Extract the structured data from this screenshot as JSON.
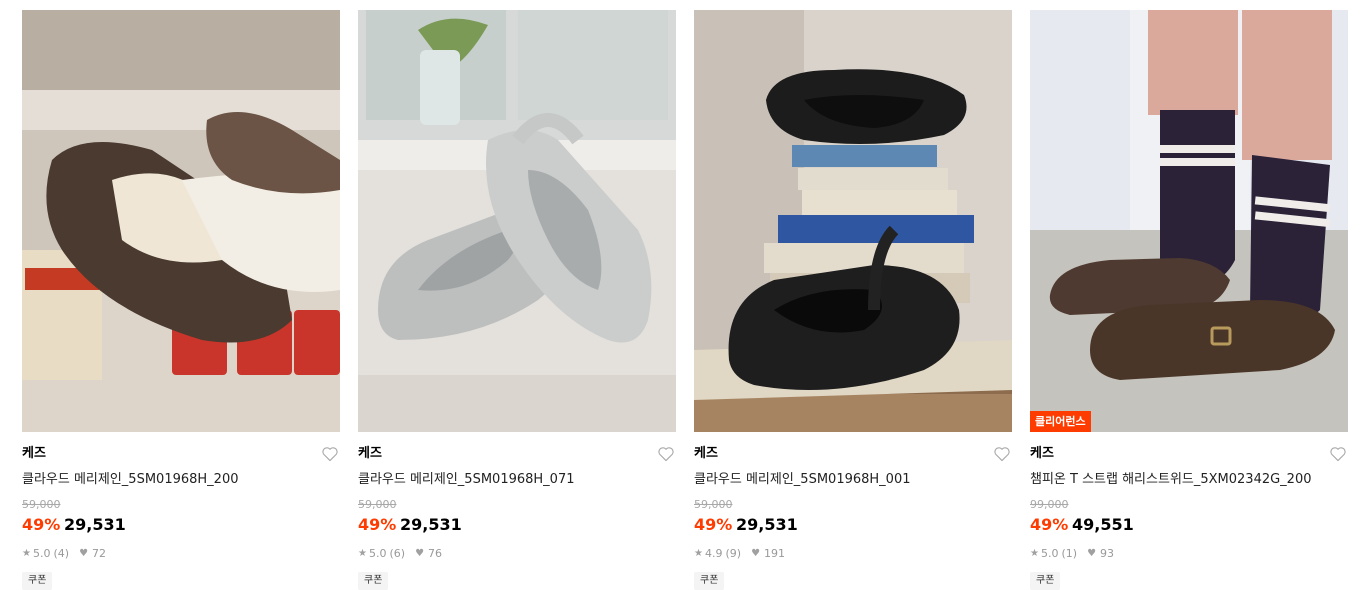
{
  "products": [
    {
      "image_alt": "brown mary jane shoes",
      "brand": "케즈",
      "name": "클라우드 메리제인_5SM01968H_200",
      "original_price": "59,000",
      "discount": "49%",
      "price": "29,531",
      "rating": "5.0",
      "review_count": "(4)",
      "likes": "72",
      "coupon": "쿠폰",
      "badge": ""
    },
    {
      "image_alt": "silver mary jane shoes",
      "brand": "케즈",
      "name": "클라우드 메리제인_5SM01968H_071",
      "original_price": "59,000",
      "discount": "49%",
      "price": "29,531",
      "rating": "5.0",
      "review_count": "(6)",
      "likes": "76",
      "coupon": "쿠폰",
      "badge": ""
    },
    {
      "image_alt": "black mary jane shoes on books",
      "brand": "케즈",
      "name": "클라우드 메리제인_5SM01968H_001",
      "original_price": "59,000",
      "discount": "49%",
      "price": "29,531",
      "rating": "4.9",
      "review_count": "(9)",
      "likes": "191",
      "coupon": "쿠폰",
      "badge": ""
    },
    {
      "image_alt": "brown tweed t-strap shoes with navy socks",
      "brand": "케즈",
      "name": "챔피온 T 스트랩 해리스트위드_5XM02342G_200",
      "original_price": "99,000",
      "discount": "49%",
      "price": "49,551",
      "rating": "5.0",
      "review_count": "(1)",
      "likes": "93",
      "coupon": "쿠폰",
      "badge": "클리어런스"
    }
  ],
  "icons": {
    "like": "heart-outline-icon",
    "rating": "star-icon",
    "likes": "heart-icon"
  },
  "colors": {
    "discount": "#ff3c00",
    "badge_bg": "#ff3c00",
    "muted": "#999999"
  }
}
